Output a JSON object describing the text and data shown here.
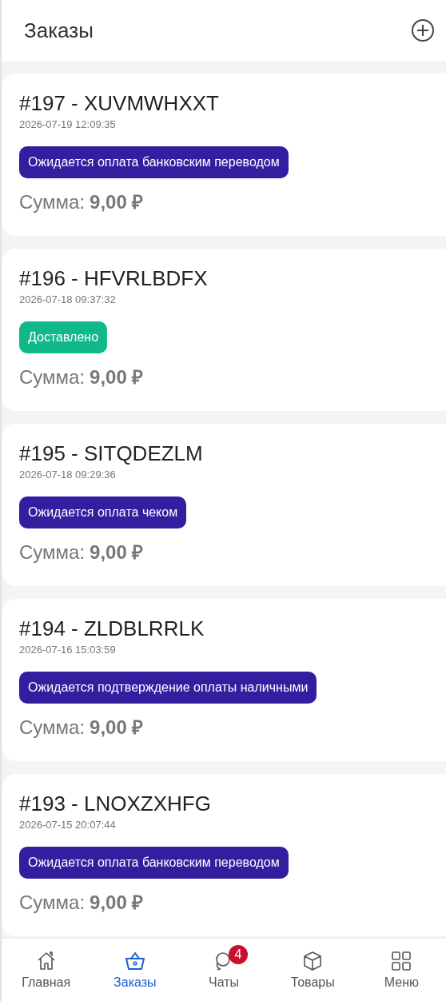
{
  "header": {
    "title": "Заказы"
  },
  "orders": [
    {
      "title": "#197 - XUVMWHXXT",
      "date": "2026-07-19 12:09:35",
      "status": "Ожидается оплата банковским переводом",
      "color": "#331ea0",
      "sum_label": "Сумма:",
      "sum": "9,00 ₽"
    },
    {
      "title": "#196 - HFVRLBDFX",
      "date": "2026-07-18 09:37:32",
      "status": "Доставлено",
      "color": "#11b98a",
      "sum_label": "Сумма:",
      "sum": "9,00 ₽"
    },
    {
      "title": "#195 - SITQDEZLM",
      "date": "2026-07-18 09:29:36",
      "status": "Ожидается оплата чеком",
      "color": "#331ea0",
      "sum_label": "Сумма:",
      "sum": "9,00 ₽"
    },
    {
      "title": "#194 - ZLDBLRRLK",
      "date": "2026-07-16 15:03:59",
      "status": "Ожидается подтверждение оплаты наличными",
      "color": "#331ea0",
      "sum_label": "Сумма:",
      "sum": "9,00 ₽"
    },
    {
      "title": "#193 - LNOXZXHFG",
      "date": "2026-07-15 20:07:44",
      "status": "Ожидается оплата банковским переводом",
      "color": "#331ea0",
      "sum_label": "Сумма:",
      "sum": "9,00 ₽"
    }
  ],
  "nav": [
    {
      "kind": "home",
      "label": "Главная",
      "selected": false
    },
    {
      "kind": "orders",
      "label": "Заказы",
      "selected": true
    },
    {
      "kind": "chats",
      "label": "Чаты",
      "selected": false,
      "badge": "4"
    },
    {
      "kind": "products",
      "label": "Товары",
      "selected": false
    },
    {
      "kind": "menu",
      "label": "Меню",
      "selected": false
    }
  ]
}
